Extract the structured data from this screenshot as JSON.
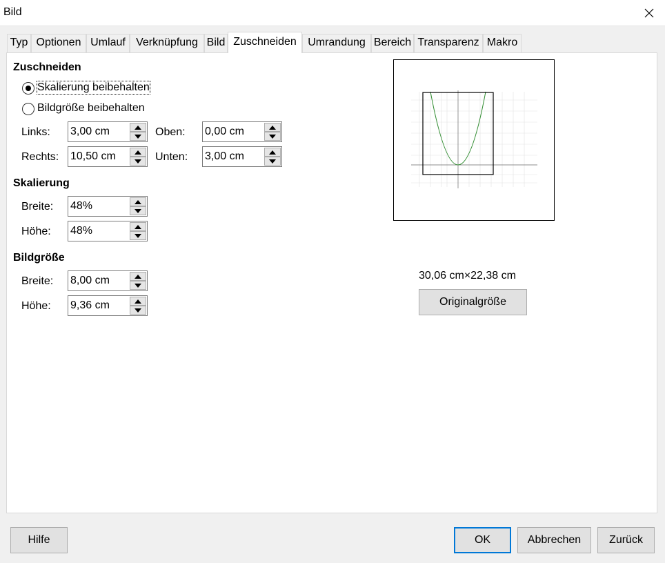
{
  "window": {
    "title": "Bild"
  },
  "tabs": [
    {
      "label": "Typ"
    },
    {
      "label": "Optionen"
    },
    {
      "label": "Umlauf"
    },
    {
      "label": "Verknüpfung"
    },
    {
      "label": "Bild"
    },
    {
      "label": "Zuschneiden"
    },
    {
      "label": "Umrandung"
    },
    {
      "label": "Bereich"
    },
    {
      "label": "Transparenz"
    },
    {
      "label": "Makro"
    }
  ],
  "crop": {
    "heading": "Zuschneiden",
    "keep_scale_label": "Skalierung beibehalten",
    "keep_size_label": "Bildgröße beibehalten",
    "left_label": "Links:",
    "left_value": "3,00 cm",
    "right_label": "Rechts:",
    "right_value": "10,50 cm",
    "top_label": "Oben:",
    "top_value": "0,00 cm",
    "bottom_label": "Unten:",
    "bottom_value": "3,00 cm"
  },
  "scale": {
    "heading": "Skalierung",
    "width_label": "Breite:",
    "width_value": "48%",
    "height_label": "Höhe:",
    "height_value": "48%"
  },
  "imgsize": {
    "heading": "Bildgröße",
    "width_label": "Breite:",
    "width_value": "8,00 cm",
    "height_label": "Höhe:",
    "height_value": "9,36 cm"
  },
  "original": {
    "size_text": "30,06 cm×22,38 cm",
    "button_label": "Originalgröße"
  },
  "footer": {
    "help": "Hilfe",
    "ok": "OK",
    "cancel": "Abbrechen",
    "reset": "Zurück"
  },
  "colors": {
    "accent": "#0078d7",
    "curve": "#2e8b2e"
  }
}
